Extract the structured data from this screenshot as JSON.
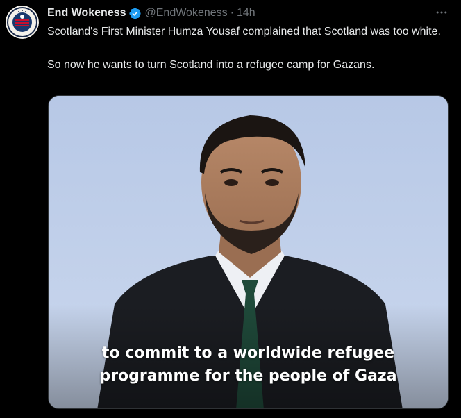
{
  "tweet": {
    "display_name": "End Wokeness",
    "handle": "@EndWokeness",
    "separator": "·",
    "time": "14h",
    "verified_icon": "verified-badge-icon",
    "more_icon": "more-options-icon",
    "text_paragraphs": [
      "Scotland's First Minister Humza Yousaf complained that Scotland was too white.",
      "So now he wants to turn Scotland into a refugee camp for Gazans."
    ],
    "media": {
      "caption_lines": [
        "to commit to a worldwide refugee",
        "programme for the people of Gaza"
      ]
    }
  },
  "colors": {
    "background": "#000000",
    "text_primary": "#e7e9ea",
    "text_secondary": "#71767b",
    "verified_blue": "#1d9bf0",
    "media_backdrop": "#c3d2ea"
  }
}
